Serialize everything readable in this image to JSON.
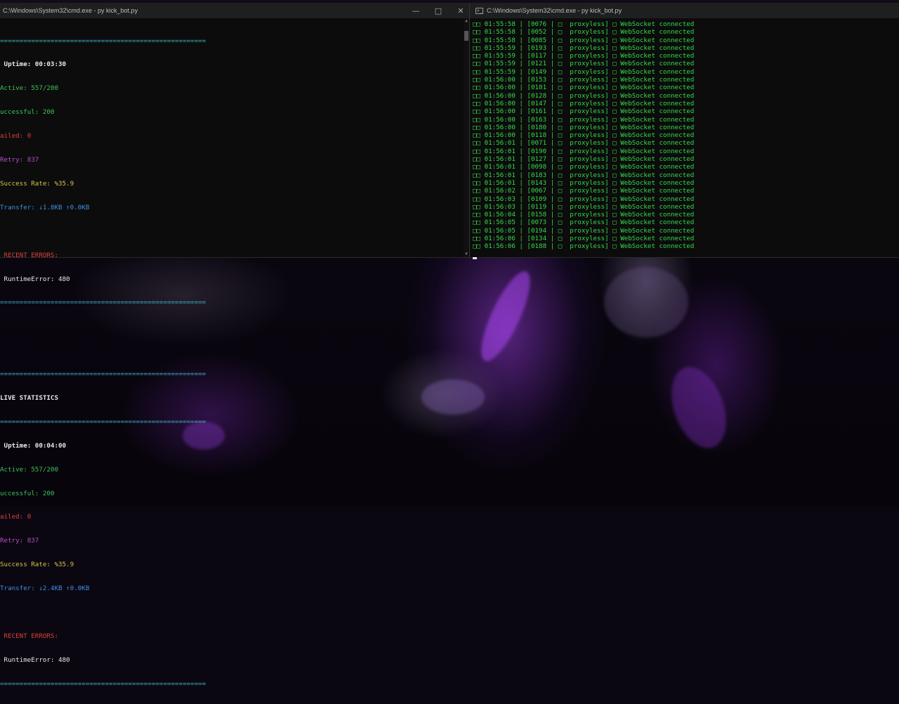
{
  "colors": {
    "separator": "#3fb3c8",
    "active": "#3ec35a",
    "failed": "#d9413f",
    "retry": "#b44fc8",
    "success_rate": "#d9c34a",
    "transfer": "#3e8ee8",
    "log_text": "#36d84a"
  },
  "left_window": {
    "title": "C:\\Windows\\System32\\cmd.exe - py  kick_bot.py",
    "icons": [
      "minimize-icon",
      "maximize-icon",
      "close-icon"
    ],
    "separator": "=====================================================",
    "block1": {
      "uptime": " Uptime: 00:03:30",
      "active": "Active: 557/200",
      "successful": "uccessful: 200",
      "failed": "ailed: 0",
      "retry": "Retry: 837",
      "success_rate": "Success Rate: %35.9",
      "transfer": "Transfer: ↓1.8KB ↑0.0KB",
      "recent_errors": " RECENT ERRORS:",
      "runtime_error": " RuntimeError: 480"
    },
    "live_header": "LIVE STATISTICS",
    "block2": {
      "uptime": " Uptime: 00:04:00",
      "active": "Active: 557/200",
      "successful": "uccessful: 200",
      "failed": "ailed: 0",
      "retry": "Retry: 837",
      "success_rate": "Success Rate: %35.9",
      "transfer": "Transfer: ↓2.4KB ↑0.0KB",
      "recent_errors": " RECENT ERRORS:",
      "runtime_error": " RuntimeError: 480"
    }
  },
  "right_window": {
    "title": "C:\\Windows\\System32\\cmd.exe - py  kick_bot.py",
    "log_lines": [
      "□□ 01:55:58 | [0076 | □  proxyless] □ WebSocket connected",
      "□□ 01:55:58 | [0052 | □  proxyless] □ WebSocket connected",
      "□□ 01:55:58 | [0085 | □  proxyless] □ WebSocket connected",
      "□□ 01:55:59 | [0193 | □  proxyless] □ WebSocket connected",
      "□□ 01:55:59 | [0117 | □  proxyless] □ WebSocket connected",
      "□□ 01:55:59 | [0121 | □  proxyless] □ WebSocket connected",
      "□□ 01:55:59 | [0149 | □  proxyless] □ WebSocket connected",
      "□□ 01:56:00 | [0153 | □  proxyless] □ WebSocket connected",
      "□□ 01:56:00 | [0101 | □  proxyless] □ WebSocket connected",
      "□□ 01:56:00 | [0128 | □  proxyless] □ WebSocket connected",
      "□□ 01:56:00 | [0147 | □  proxyless] □ WebSocket connected",
      "□□ 01:56:00 | [0161 | □  proxyless] □ WebSocket connected",
      "□□ 01:56:00 | [0163 | □  proxyless] □ WebSocket connected",
      "□□ 01:56:00 | [0180 | □  proxyless] □ WebSocket connected",
      "□□ 01:56:00 | [0118 | □  proxyless] □ WebSocket connected",
      "□□ 01:56:01 | [0071 | □  proxyless] □ WebSocket connected",
      "□□ 01:56:01 | [0190 | □  proxyless] □ WebSocket connected",
      "□□ 01:56:01 | [0127 | □  proxyless] □ WebSocket connected",
      "□□ 01:56:01 | [0098 | □  proxyless] □ WebSocket connected",
      "□□ 01:56:01 | [0183 | □  proxyless] □ WebSocket connected",
      "□□ 01:56:01 | [0143 | □  proxyless] □ WebSocket connected",
      "□□ 01:56:02 | [0067 | □  proxyless] □ WebSocket connected",
      "□□ 01:56:03 | [0109 | □  proxyless] □ WebSocket connected",
      "□□ 01:56:03 | [0119 | □  proxyless] □ WebSocket connected",
      "□□ 01:56:04 | [0158 | □  proxyless] □ WebSocket connected",
      "□□ 01:56:05 | [0073 | □  proxyless] □ WebSocket connected",
      "□□ 01:56:05 | [0194 | □  proxyless] □ WebSocket connected",
      "□□ 01:56:06 | [0134 | □  proxyless] □ WebSocket connected",
      "□□ 01:56:06 | [0188 | □  proxyless] □ WebSocket connected"
    ]
  }
}
